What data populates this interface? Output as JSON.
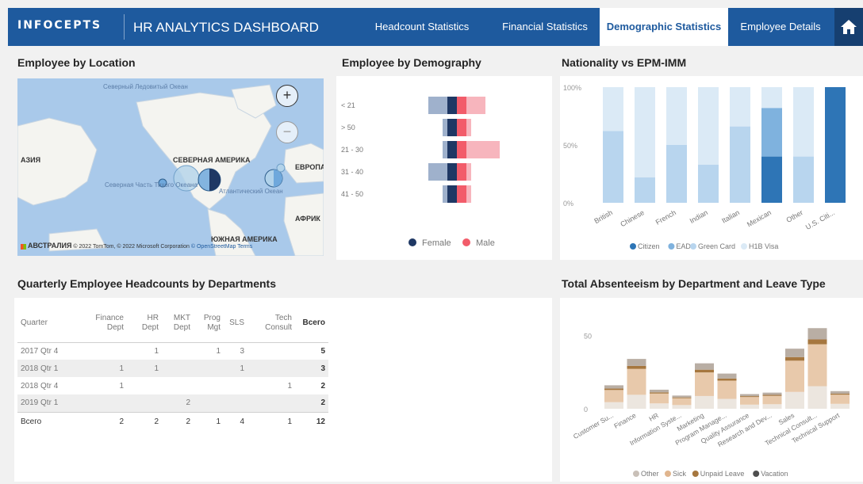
{
  "header": {
    "brand": "InfoCepts",
    "title": "HR ANALYTICS DASHBOARD",
    "tabs": [
      {
        "label": "Headcount Statistics"
      },
      {
        "label": "Financial Statistics"
      },
      {
        "label": "Demographic Statistics",
        "active": true
      },
      {
        "label": "Employee Details"
      }
    ],
    "home_icon": "home-icon"
  },
  "location": {
    "title": "Employee by Location",
    "labels": {
      "arctic": "Северный Ледовитый Океан",
      "asia": "АЗИЯ",
      "north_america": "СЕВЕРНАЯ АМЕРИКА",
      "europe": "ЕВРОПА",
      "pacific": "Северная Часть Тихого Океана",
      "atlantic": "Атлантический Океан",
      "africa": "АФРИК",
      "south_america": "ЮЖНАЯ АМЕРИКА",
      "australia": "АВСТРАЛИЯ"
    },
    "attribution": "© 2022 TomTom, © 2022 Microsoft Corporation",
    "attribution_links": "© OpenStreetMap  Terms",
    "zoom_in": "+",
    "zoom_out": "−"
  },
  "demography": {
    "title": "Employee by Demography",
    "legend": [
      {
        "label": "Female",
        "color": "#1f3864"
      },
      {
        "label": "Male",
        "color": "#f25c6a"
      }
    ],
    "chart_data": {
      "type": "bar",
      "categories": [
        "< 21",
        "> 50",
        "21 - 30",
        "31 - 40",
        "41 - 50"
      ],
      "series": [
        {
          "name": "Female",
          "values": [
            2,
            1,
            1,
            2,
            1
          ]
        },
        {
          "name": "Male",
          "values": [
            2,
            1,
            3,
            1,
            1
          ]
        }
      ]
    }
  },
  "nationality": {
    "title": "Nationality vs EPM-IMM",
    "legend": [
      {
        "label": "Citizen",
        "color": "#2e75b6"
      },
      {
        "label": "EAD",
        "color": "#7fb2de"
      },
      {
        "label": "Green Card",
        "color": "#b8d5ee"
      },
      {
        "label": "H1B Visa",
        "color": "#dbeaf6"
      }
    ],
    "chart_data": {
      "type": "bar",
      "categories": [
        "British",
        "Chinese",
        "French",
        "Indian",
        "Italian",
        "Mexican",
        "Other",
        "U.S. Citi..."
      ],
      "yticks": [
        "0%",
        "50%",
        "100%"
      ],
      "series": [
        {
          "name": "Citizen",
          "values": [
            0,
            0,
            0,
            0,
            0,
            40,
            0,
            100
          ]
        },
        {
          "name": "EAD",
          "values": [
            0,
            0,
            0,
            0,
            0,
            42,
            0,
            0
          ]
        },
        {
          "name": "Green Card",
          "values": [
            62,
            22,
            50,
            33,
            66,
            0,
            40,
            0
          ]
        },
        {
          "name": "H1B Visa",
          "values": [
            38,
            78,
            50,
            67,
            34,
            18,
            60,
            0
          ]
        }
      ]
    }
  },
  "headcount": {
    "title": "Quarterly Employee Headcounts by Departments",
    "columns": [
      "Quarter",
      "Finance Dept",
      "HR Dept",
      "MKT Dept",
      "Prog Mgt",
      "SLS",
      "Tech Consult",
      "Всего"
    ],
    "rows": [
      [
        "2017 Qtr 4",
        "",
        "1",
        "",
        "1",
        "3",
        "",
        "5"
      ],
      [
        "2018 Qtr 1",
        "1",
        "1",
        "",
        "",
        "1",
        "",
        "3"
      ],
      [
        "2018 Qtr 4",
        "1",
        "",
        "",
        "",
        "",
        "1",
        "2"
      ],
      [
        "2019 Qtr 1",
        "",
        "",
        "2",
        "",
        "",
        "",
        "2"
      ]
    ],
    "total": [
      "Всего",
      "2",
      "2",
      "2",
      "1",
      "4",
      "1",
      "12"
    ]
  },
  "absenteeism": {
    "title": "Total Absenteeism by Department and Leave Type",
    "legend": [
      {
        "label": "Other",
        "color": "#c9c0b8"
      },
      {
        "label": "Sick",
        "color": "#e0b58e"
      },
      {
        "label": "Unpaid Leave",
        "color": "#a6773f"
      },
      {
        "label": "Vacation",
        "color": "#4e4e4e"
      }
    ],
    "chart_data": {
      "type": "bar",
      "categories": [
        "Customer Su...",
        "Finance",
        "HR",
        "Information Syste...",
        "Marketing",
        "Program Manage...",
        "Quality Assurance",
        "Research and Dev...",
        "Sales",
        "Technical Consult...",
        "Technical Support"
      ],
      "yticks": [
        "0",
        "50"
      ],
      "totals": [
        16,
        34,
        13,
        9,
        31,
        24,
        10,
        11,
        41,
        55,
        12
      ]
    }
  }
}
